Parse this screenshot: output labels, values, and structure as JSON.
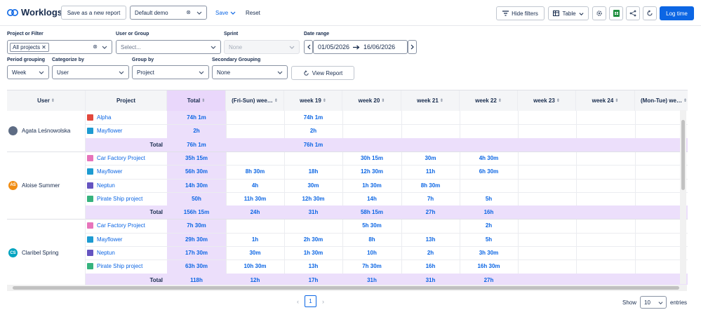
{
  "app": {
    "title": "Worklogs"
  },
  "header": {
    "save_new": "Save as a new report",
    "report_select": "Default demo",
    "save": "Save",
    "reset": "Reset",
    "hide_filters": "Hide filters",
    "view_mode": "Table",
    "log_time": "Log time"
  },
  "filters": {
    "project_label": "Project or Filter",
    "project_chip": "All projects",
    "user_label": "User or Group",
    "user_placeholder": "Select...",
    "sprint_label": "Sprint",
    "sprint_value": "None",
    "date_label": "Date range",
    "date_from": "01/05/2026",
    "date_to": "16/06/2026",
    "period_label": "Period grouping",
    "period_value": "Week",
    "categorize_label": "Categorize by",
    "categorize_value": "User",
    "group_label": "Group by",
    "group_value": "Project",
    "secondary_label": "Secondary Grouping",
    "secondary_value": "None",
    "view_report": "View Report"
  },
  "table": {
    "headers": [
      "User",
      "Project",
      "Total",
      "(Fri-Sun) wee…",
      "week 19",
      "week 20",
      "week 21",
      "week 22",
      "week 23",
      "week 24",
      "(Mon-Tue) we…"
    ],
    "groups": [
      {
        "user": "Agata Leśnowolska",
        "avatar": "",
        "avatar_color": "#5e6c84",
        "rows": [
          {
            "project": "Alpha",
            "icon_color": "#e2483d",
            "values": [
              "74h 1m",
              "",
              "74h 1m",
              "",
              "",
              "",
              "",
              "",
              ""
            ]
          },
          {
            "project": "Mayflower",
            "icon_color": "#1d9bd1",
            "values": [
              "2h",
              "",
              "2h",
              "",
              "",
              "",
              "",
              "",
              ""
            ]
          }
        ],
        "total": [
          "76h 1m",
          "",
          "76h 1m",
          "",
          "",
          "",
          "",
          "",
          ""
        ]
      },
      {
        "user": "Aloise Summer",
        "avatar": "AS",
        "avatar_color": "#f18d13",
        "rows": [
          {
            "project": "Car Factory Project",
            "icon_color": "#e774bb",
            "values": [
              "35h 15m",
              "",
              "",
              "30h 15m",
              "30m",
              "4h 30m",
              "",
              "",
              ""
            ]
          },
          {
            "project": "Mayflower",
            "icon_color": "#1d9bd1",
            "values": [
              "56h 30m",
              "8h 30m",
              "18h",
              "12h 30m",
              "11h",
              "6h 30m",
              "",
              "",
              ""
            ]
          },
          {
            "project": "Neptun",
            "icon_color": "#6554c0",
            "values": [
              "14h 30m",
              "4h",
              "30m",
              "1h 30m",
              "8h 30m",
              "",
              "",
              "",
              ""
            ]
          },
          {
            "project": "Pirate Ship project",
            "icon_color": "#36b37e",
            "values": [
              "50h",
              "11h 30m",
              "12h 30m",
              "14h",
              "7h",
              "5h",
              "",
              "",
              ""
            ]
          }
        ],
        "total": [
          "156h 15m",
          "24h",
          "31h",
          "58h 15m",
          "27h",
          "16h",
          "",
          "",
          ""
        ]
      },
      {
        "user": "Claribel Spring",
        "avatar": "CS",
        "avatar_color": "#00a3bf",
        "rows": [
          {
            "project": "Car Factory Project",
            "icon_color": "#e774bb",
            "values": [
              "7h 30m",
              "",
              "",
              "5h 30m",
              "",
              "2h",
              "",
              "",
              ""
            ]
          },
          {
            "project": "Mayflower",
            "icon_color": "#1d9bd1",
            "values": [
              "29h 30m",
              "1h",
              "2h 30m",
              "8h",
              "13h",
              "5h",
              "",
              "",
              ""
            ]
          },
          {
            "project": "Neptun",
            "icon_color": "#6554c0",
            "values": [
              "17h 30m",
              "30m",
              "1h 30m",
              "10h",
              "2h",
              "3h 30m",
              "",
              "",
              ""
            ]
          },
          {
            "project": "Pirate Ship project",
            "icon_color": "#36b37e",
            "values": [
              "63h 30m",
              "10h 30m",
              "13h",
              "7h 30m",
              "16h",
              "16h 30m",
              "",
              "",
              ""
            ]
          }
        ],
        "total": [
          "118h",
          "12h",
          "17h",
          "31h",
          "31h",
          "27h",
          "",
          "",
          ""
        ]
      }
    ],
    "total_label": "Total"
  },
  "pagination": {
    "current": "1",
    "show_label": "Show",
    "page_size": "10",
    "entries_label": "entries"
  },
  "colors": {
    "accent": "#0c66e4",
    "total_bg": "#ecdffb",
    "sheets_green": "#1e8e3e"
  }
}
